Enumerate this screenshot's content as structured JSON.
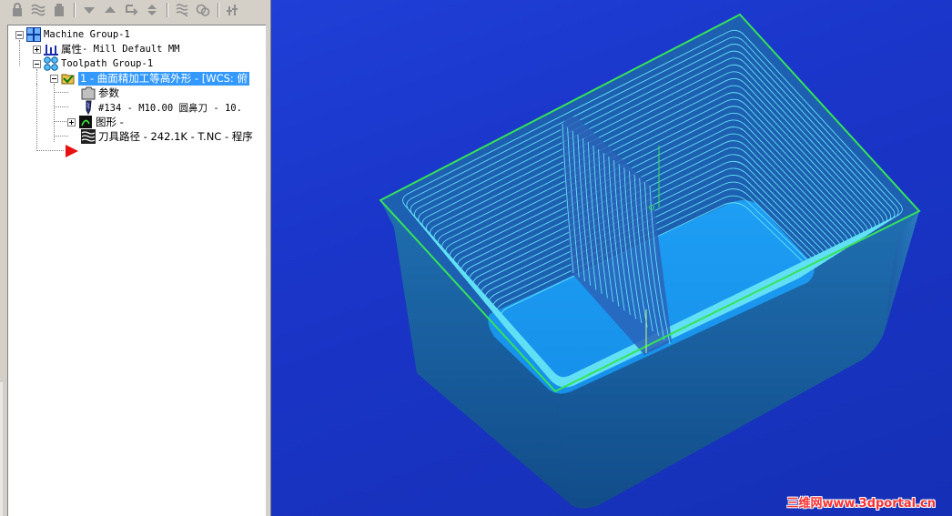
{
  "toolbar": {
    "buttons": [
      {
        "icon": "lock-icon"
      },
      {
        "icon": "waves-icon"
      },
      {
        "icon": "lock-closed-icon"
      },
      {
        "icon": "arrow-down-icon"
      },
      {
        "icon": "arrow-up-icon"
      },
      {
        "icon": "loop-arrow-icon"
      },
      {
        "icon": "up-down-arrow-icon"
      },
      {
        "icon": "toolpath-display-icon"
      },
      {
        "icon": "regenerate-icon"
      },
      {
        "icon": "post-process-icon"
      }
    ]
  },
  "tree": {
    "machine_group": "Machine Group-1",
    "properties_label": "属性",
    "properties_value": " - Mill Default MM",
    "toolpath_group": "Toolpath Group-1",
    "operation_label": "1 - 曲面精加工等高外形 - [WCS: 俯",
    "parameters": "参数",
    "tool": "#134 - M10.00 圆鼻刀 -    10.",
    "geometry": "图形 -",
    "toolpath": "刀具路径 - 242.1K - T.NC - 程序"
  },
  "watermark": "三维网www.3dportal.cn",
  "colors": {
    "viewport_bg": "#1a35c8",
    "wireframe_green": "#35e35a",
    "toolpath_cyan": "#62e0f5",
    "part_body": "#1f64a8",
    "selection": "#3399ff"
  }
}
